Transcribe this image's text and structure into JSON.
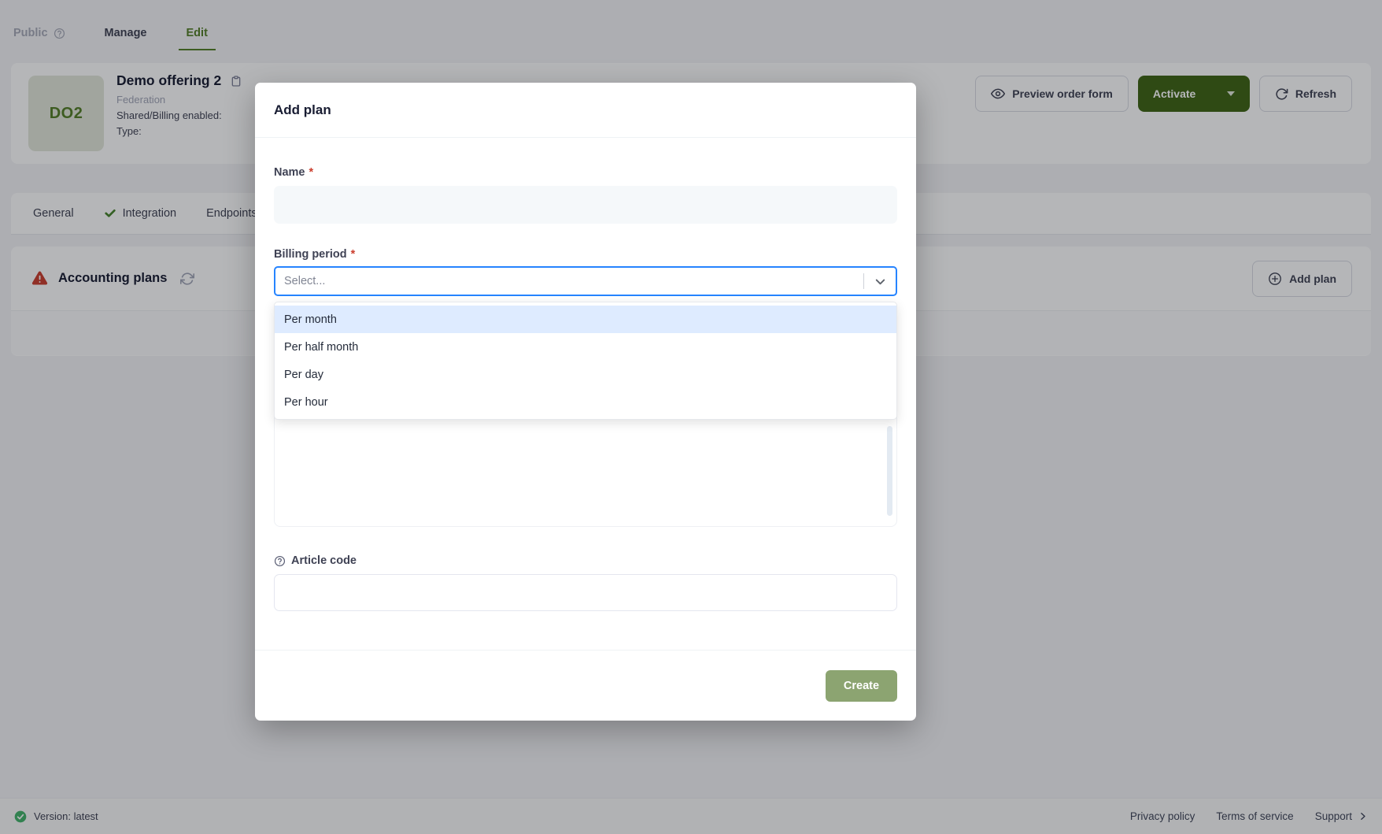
{
  "page": {
    "top_tabs": [
      {
        "label": "Public",
        "state": "muted"
      },
      {
        "label": "Manage",
        "state": "normal"
      },
      {
        "label": "Edit",
        "state": "active"
      }
    ],
    "offering": {
      "avatar": "DO2",
      "title": "Demo offering 2",
      "category": "Federation",
      "fields": [
        "Shared/Billing enabled:",
        "Type:"
      ]
    },
    "actions": {
      "preview": "Preview order form",
      "activate": "Activate",
      "refresh": "Refresh"
    },
    "section_tabs": [
      {
        "label": "General",
        "checked": false
      },
      {
        "label": "Integration",
        "checked": true
      },
      {
        "label": "Endpoints",
        "checked": false
      }
    ],
    "accounting": {
      "title": "Accounting plans",
      "add_button": "Add plan"
    },
    "footer": {
      "version": "Version: latest",
      "links": [
        "Privacy policy",
        "Terms of service",
        "Support"
      ]
    }
  },
  "modal": {
    "title": "Add plan",
    "required_mark": "*",
    "fields": {
      "name": {
        "label": "Name",
        "value": ""
      },
      "billing": {
        "label": "Billing period",
        "placeholder": "Select...",
        "options": [
          "Per month",
          "Per half month",
          "Per day",
          "Per hour"
        ],
        "focused_option": "Per month"
      },
      "article": {
        "label": "Article code",
        "value": ""
      }
    },
    "create_label": "Create"
  },
  "icons": {
    "help-circle": "?",
    "copy": "clipboard",
    "eye": "preview",
    "caret-down": "▾",
    "refresh": "rotate-cw",
    "check": "✓",
    "warning-triangle": "!",
    "sync": "refresh-cw",
    "plus-circle": "⊕",
    "chevron-down": "⌄",
    "check-circle": "✓",
    "chevron-right": "›"
  },
  "colors": {
    "accent_green": "#547f27",
    "activate_button_green": "#3f6515",
    "focus_blue": "#2684ff",
    "option_highlight": "#deebff",
    "danger_red": "#cb3e2e",
    "success_green": "#44b36b",
    "create_button_green": "#8ca471",
    "input_solid_bg": "#f5f8fa"
  }
}
